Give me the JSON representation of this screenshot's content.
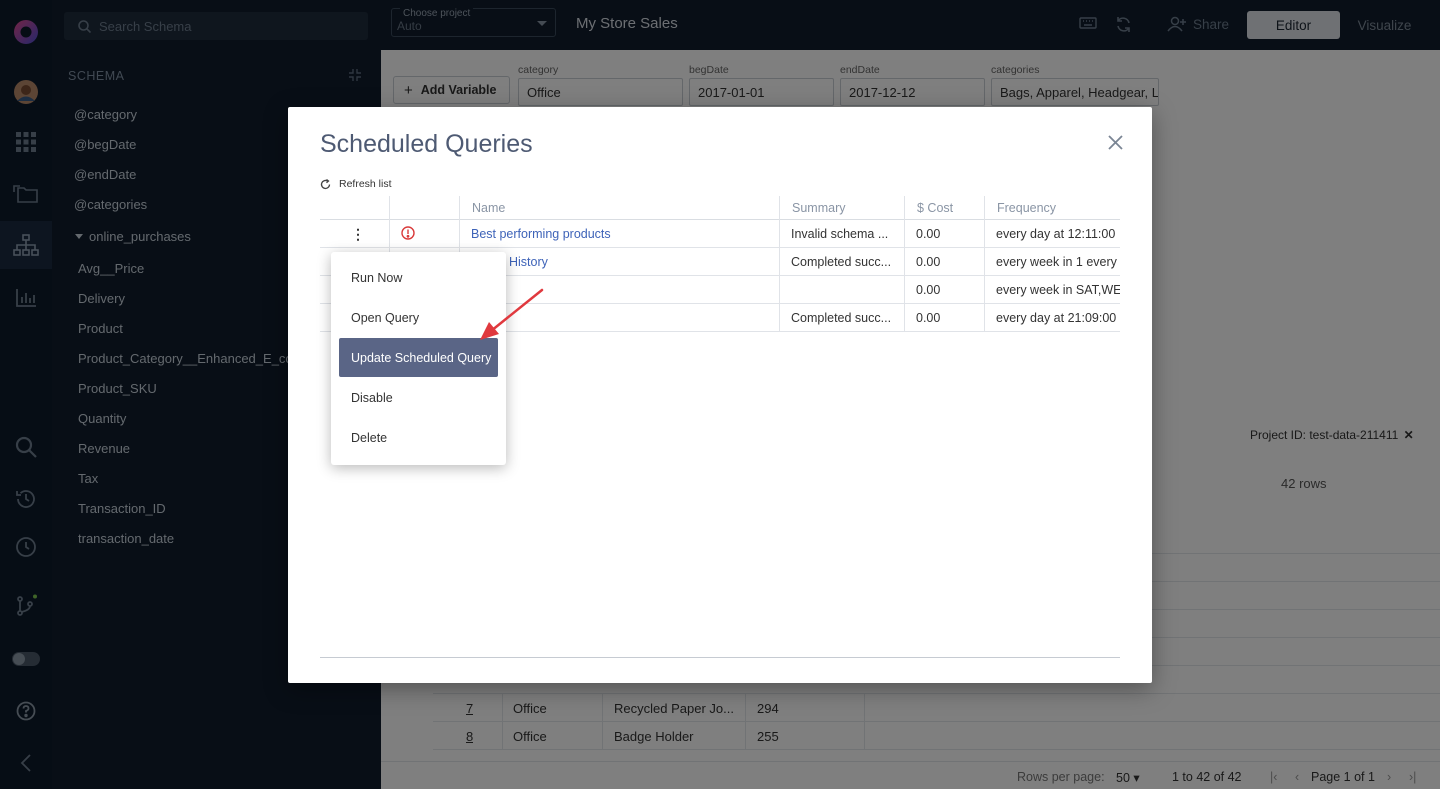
{
  "sidebar": {
    "search_placeholder": "Search Schema",
    "schema_title": "SCHEMA",
    "variables": [
      "@category",
      "@begDate",
      "@endDate",
      "@categories"
    ],
    "table_name": "online_purchases",
    "columns": [
      "Avg__Price",
      "Delivery",
      "Product",
      "Product_Category__Enhanced_E_com",
      "Product_SKU",
      "Quantity",
      "Revenue",
      "Tax",
      "Transaction_ID",
      "transaction_date"
    ]
  },
  "topbar": {
    "project_label": "Choose project",
    "project_value": "Auto",
    "title": "My Store Sales",
    "share_label": "Share",
    "editor_label": "Editor",
    "visualize_label": "Visualize"
  },
  "variables_bar": {
    "add_variable_label": "Add Variable",
    "fields": [
      {
        "label": "category",
        "value": "Office"
      },
      {
        "label": "begDate",
        "value": "2017-01-01"
      },
      {
        "label": "endDate",
        "value": "2017-12-12"
      },
      {
        "label": "categories",
        "value": "Bags, Apparel, Headgear, L"
      }
    ]
  },
  "results": {
    "project_id": "Project ID: test-data-211411",
    "rows_count": "42 rows",
    "visible_rows": [
      {
        "num": "7",
        "category": "Office",
        "product": "Recycled Paper Jo...",
        "value": "294"
      },
      {
        "num": "8",
        "category": "Office",
        "product": "Badge Holder",
        "value": "255"
      }
    ],
    "rows_per_page_label": "Rows per page:",
    "rows_per_page": "50",
    "range": "1 to 42 of 42",
    "page": "Page 1 of 1"
  },
  "modal": {
    "title": "Scheduled Queries",
    "refresh_label": "Refresh list",
    "headers": [
      "Name",
      "Summary",
      "$ Cost",
      "Frequency"
    ],
    "rows": [
      {
        "name": "Best performing products",
        "summary": "Invalid schema ...",
        "cost": "0.00",
        "frequency": "every day at 12:11:00",
        "has_error": true
      },
      {
        "name": "History",
        "summary": "Completed succ...",
        "cost": "0.00",
        "frequency": "every week in 1 every",
        "has_error": false
      },
      {
        "name": "",
        "summary": "",
        "cost": "0.00",
        "frequency": "every week in SAT,WE",
        "has_error": false
      },
      {
        "name": "",
        "summary": "Completed succ...",
        "cost": "0.00",
        "frequency": "every day at 21:09:00",
        "has_error": false
      }
    ]
  },
  "context_menu": {
    "items": [
      "Run Now",
      "Open Query",
      "Update Scheduled Query",
      "Disable",
      "Delete"
    ],
    "highlighted": "Update Scheduled Query"
  },
  "colors": {
    "accent": "#5a6586",
    "link": "#3e63b8",
    "arrow": "#e0393e",
    "error": "#d93a3a"
  }
}
